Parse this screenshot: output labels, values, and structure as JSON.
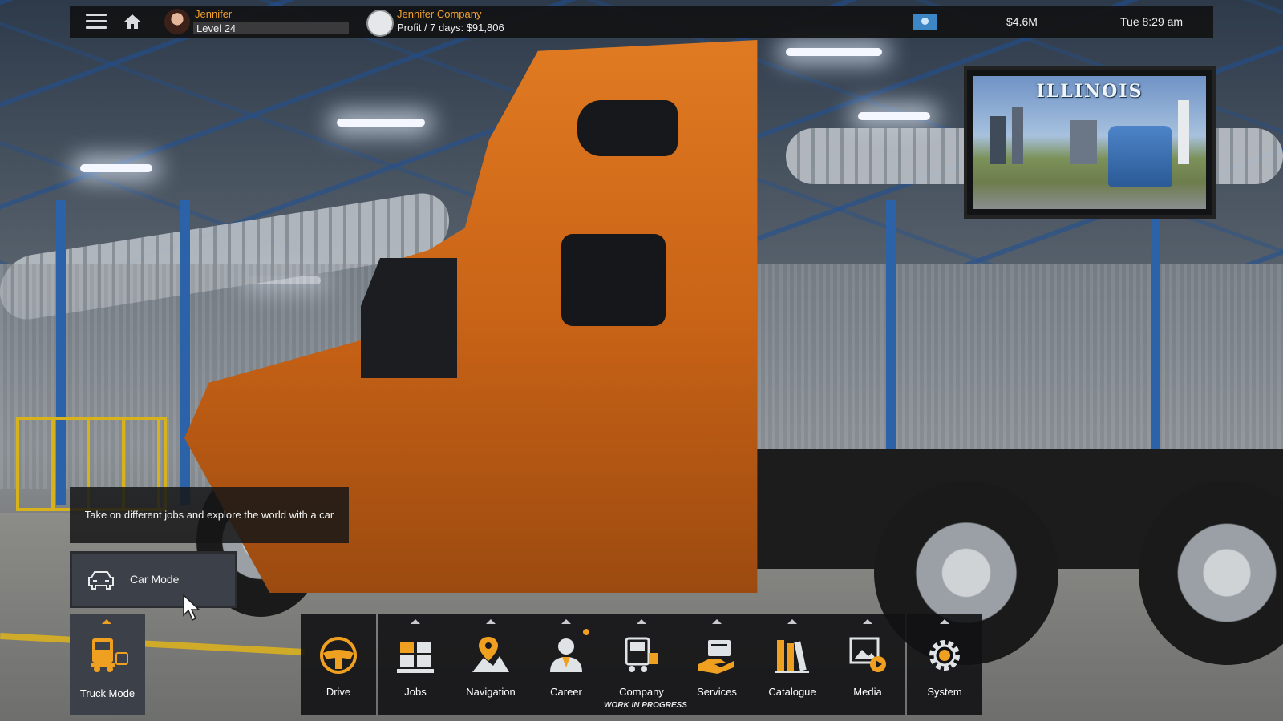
{
  "topbar": {
    "player_name": "Jennifer",
    "level_label": "Level 24",
    "level_progress": 0.0,
    "company_name": "Jennifer Company",
    "profit_text": "Profit / 7 days: $91,806",
    "money": "$4.6M",
    "clock": "Tue 8:29 am",
    "icons": [
      "hamburger-menu-icon",
      "home-icon",
      "avatar",
      "company-logo-icon",
      "flag-icon"
    ]
  },
  "billboard": {
    "title": "ILLINOIS"
  },
  "tooltip": {
    "text": "Take on different jobs and explore the world with a car"
  },
  "car_mode": {
    "label": "Car Mode",
    "icon": "car-icon"
  },
  "truck_mode": {
    "label": "Truck Mode",
    "icon": "truck-icon",
    "accent": "#f0a020"
  },
  "dock": {
    "items": [
      {
        "label": "Drive",
        "icon": "steering-wheel-icon"
      },
      {
        "label": "Jobs",
        "icon": "jobs-boxes-icon"
      },
      {
        "label": "Navigation",
        "icon": "map-pin-icon"
      },
      {
        "label": "Career",
        "icon": "person-icon",
        "badge": true
      },
      {
        "label": "Company",
        "icon": "company-truck-icon",
        "note": "WORK IN PROGRESS"
      },
      {
        "label": "Services",
        "icon": "services-hand-icon"
      },
      {
        "label": "Catalogue",
        "icon": "books-icon"
      },
      {
        "label": "Media",
        "icon": "media-play-icon"
      },
      {
        "label": "System",
        "icon": "gear-icon"
      }
    ]
  },
  "colors": {
    "accent_orange": "#f3a12b",
    "panel_dark": "#121214",
    "panel_slate": "#3c4048"
  }
}
